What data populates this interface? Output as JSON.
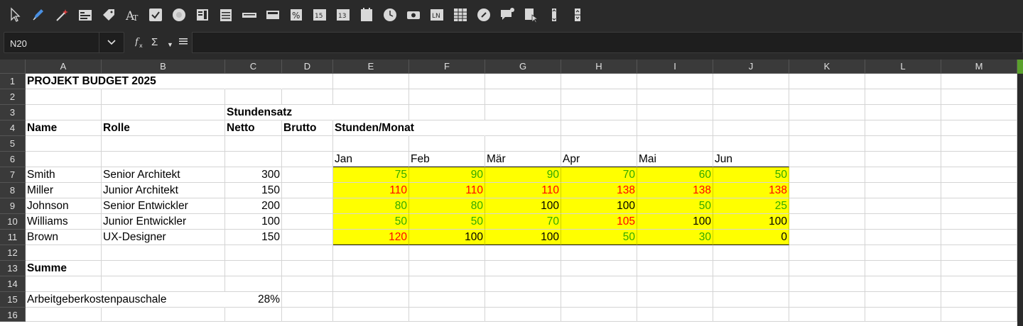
{
  "toolbar": {
    "icons": [
      "select-arrow-icon",
      "pen-icon",
      "magic-wand-icon",
      "form-icon",
      "tag-icon",
      "fontwork-icon",
      "checkbox-icon",
      "radio-icon",
      "list-icon",
      "table-icon",
      "rect-icon",
      "frame-icon",
      "percent-icon",
      "number-icon",
      "number2-icon",
      "calendar-icon",
      "time-icon",
      "image-button-icon",
      "ln-icon",
      "grid-icon",
      "navigator-icon",
      "speech-icon",
      "cursor-doc-icon",
      "vscroll-icon",
      "spin-icon"
    ]
  },
  "formula_bar": {
    "name_box": "N20",
    "formula": ""
  },
  "columns": [
    "A",
    "B",
    "C",
    "D",
    "E",
    "F",
    "G",
    "H",
    "I",
    "J",
    "K",
    "L",
    "M"
  ],
  "rows": [
    "1",
    "2",
    "3",
    "4",
    "5",
    "6",
    "7",
    "8",
    "9",
    "10",
    "11",
    "12",
    "13",
    "14",
    "15",
    "16"
  ],
  "colors": {
    "yellow": "#ffff00",
    "green": "#33aa00",
    "red": "#ff0000",
    "black": "#000000"
  },
  "sheet": {
    "title": "PROJEKT BUDGET 2025",
    "stundensatz": "Stundensatz",
    "headers": {
      "name": "Name",
      "rolle": "Rolle",
      "netto": "Netto",
      "brutto": "Brutto",
      "stunden": "Stunden/Monat"
    },
    "months": [
      "Jan",
      "Feb",
      "Mär",
      "Apr",
      "Mai",
      "Jun"
    ],
    "people": [
      {
        "name": "Smith",
        "role": "Senior Architekt",
        "rate": "300",
        "hours": [
          "75",
          "90",
          "90",
          "70",
          "60",
          "50"
        ],
        "colors": [
          "green",
          "green",
          "green",
          "green",
          "green",
          "green"
        ]
      },
      {
        "name": "Miller",
        "role": "Junior Architekt",
        "rate": "150",
        "hours": [
          "110",
          "110",
          "110",
          "138",
          "138",
          "138"
        ],
        "colors": [
          "red",
          "red",
          "red",
          "red",
          "red",
          "red"
        ]
      },
      {
        "name": "Johnson",
        "role": "Senior Entwickler",
        "rate": "200",
        "hours": [
          "80",
          "80",
          "100",
          "100",
          "50",
          "25"
        ],
        "colors": [
          "green",
          "green",
          "black",
          "black",
          "green",
          "green"
        ]
      },
      {
        "name": "Williams",
        "role": "Junior Entwickler",
        "rate": "100",
        "hours": [
          "50",
          "50",
          "70",
          "105",
          "100",
          "100"
        ],
        "colors": [
          "green",
          "green",
          "green",
          "red",
          "black",
          "black"
        ]
      },
      {
        "name": "Brown",
        "role": "UX-Designer",
        "rate": "150",
        "hours": [
          "120",
          "100",
          "100",
          "50",
          "30",
          "0"
        ],
        "colors": [
          "red",
          "black",
          "black",
          "green",
          "green",
          "black"
        ]
      }
    ],
    "summe": "Summe",
    "pauschale_label": "Arbeitgeberkostenpauschale",
    "pauschale_value": "28%"
  }
}
